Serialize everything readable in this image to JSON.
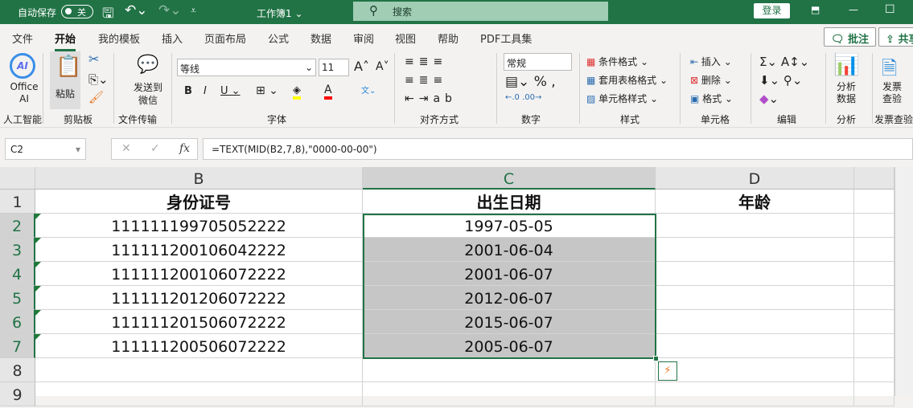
{
  "titlebar": {
    "autosave_label": "自动保存",
    "autosave_state": "关",
    "workbook": "工作簿1 ⌄",
    "search": "搜索",
    "login": "登录"
  },
  "tabs": [
    "文件",
    "开始",
    "我的模板",
    "插入",
    "页面布局",
    "公式",
    "数据",
    "审阅",
    "视图",
    "帮助",
    "PDF工具集"
  ],
  "active_tab": "开始",
  "comment_btn": "批注",
  "share_btn": "共享",
  "ribbon": {
    "office_ai": "Office AI",
    "paste": "粘贴",
    "send_wechat": "发送到微信",
    "font_name": "等线",
    "font_size": "11",
    "number_format": "常规",
    "cond_format": "条件格式 ⌄",
    "table_format": "套用表格格式 ⌄",
    "cell_style": "单元格样式 ⌄",
    "insert": "插入",
    "delete": "删除",
    "format": "格式",
    "analyze": "分析数据",
    "invoice": "发票查验",
    "groups": [
      "人工智能",
      "剪贴板",
      "文件传输",
      "字体",
      "对齐方式",
      "数字",
      "样式",
      "单元格",
      "编辑",
      "分析",
      "发票查验"
    ],
    "font_color": "#ff0000",
    "fill_color": "#ffff00"
  },
  "namebox": "C2",
  "formula": "=TEXT(MID(B2,7,8),\"0000-00-00\")",
  "columns": [
    "B",
    "C",
    "D"
  ],
  "rows": [
    "1",
    "2",
    "3",
    "4",
    "5",
    "6",
    "7",
    "8",
    "9"
  ],
  "sheet": {
    "headers": [
      "身份证号",
      "出生日期",
      "年龄"
    ],
    "ids": [
      "111111199705052222",
      "111111200106042222",
      "111111200106072222",
      "111111201206072222",
      "111111201506072222",
      "111111200506072222"
    ],
    "dates": [
      "1997-05-05",
      "2001-06-04",
      "2001-06-07",
      "2012-06-07",
      "2015-06-07",
      "2005-06-07"
    ]
  }
}
